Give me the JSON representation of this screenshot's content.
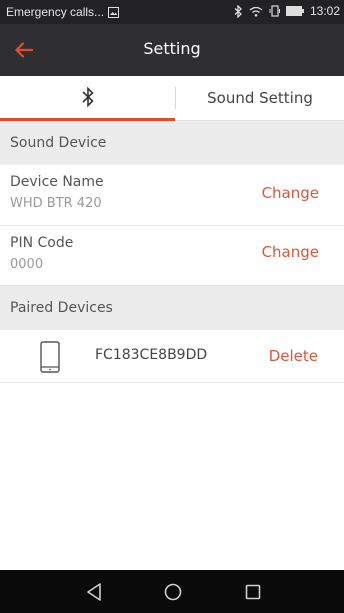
{
  "status_bar": {
    "left_text": "Emergency calls...",
    "time": "13:02",
    "icons": [
      "image-icon",
      "bluetooth-icon",
      "wifi-icon",
      "vibrate-icon",
      "battery-icon"
    ]
  },
  "app_bar": {
    "title": "Setting",
    "back_icon": "arrow-left-icon",
    "accent_color": "#e34b2f"
  },
  "tabs": [
    {
      "icon": "bluetooth-icon",
      "label": "",
      "selected": true
    },
    {
      "label": "Sound Setting",
      "selected": false
    }
  ],
  "sound_device": {
    "header": "Sound Device",
    "rows": [
      {
        "label": "Device Name",
        "value": "WHD BTR 420",
        "action": "Change"
      },
      {
        "label": "PIN Code",
        "value": "0000",
        "action": "Change"
      }
    ]
  },
  "paired_devices": {
    "header": "Paired Devices",
    "items": [
      {
        "icon": "phone-icon",
        "name": "FC183CE8B9DD",
        "action": "Delete"
      }
    ]
  },
  "nav_bar": {
    "buttons": [
      "back-triangle-icon",
      "home-circle-icon",
      "recents-square-icon"
    ]
  }
}
